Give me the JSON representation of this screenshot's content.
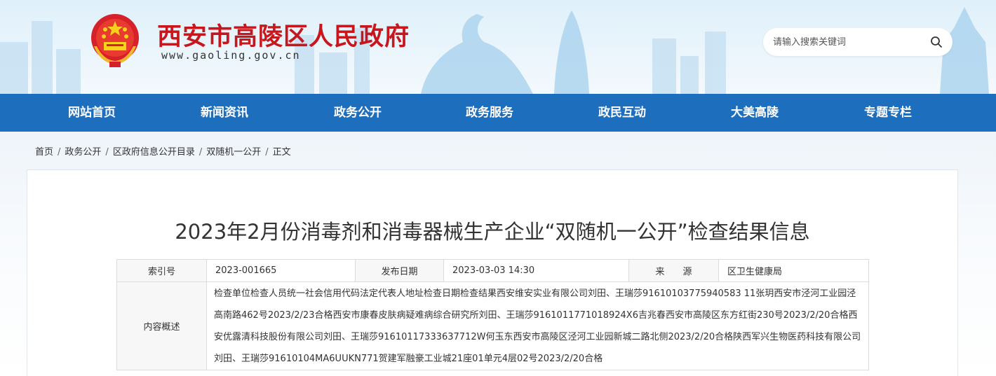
{
  "header": {
    "site_title": "西安市高陵区人民政府",
    "site_domain": "www.gaoling.gov.cn",
    "emblem_icon": "national-emblem-icon",
    "colors": {
      "title_red": "#c8161d",
      "nav_blue": "#1e6ebe"
    }
  },
  "search": {
    "placeholder": "请输入搜索关键词",
    "icon": "search-icon"
  },
  "nav": {
    "items": [
      {
        "label": "网站首页"
      },
      {
        "label": "新闻资讯"
      },
      {
        "label": "政务公开"
      },
      {
        "label": "政务服务"
      },
      {
        "label": "政民互动"
      },
      {
        "label": "大美高陵"
      },
      {
        "label": "专题专栏"
      }
    ]
  },
  "breadcrumb": {
    "items": [
      "首页",
      "政务公开",
      "区政府信息公开目录",
      "双随机一公开",
      "正文"
    ],
    "separator": "/"
  },
  "article": {
    "title": "2023年2月份消毒剂和消毒器械生产企业“双随机一公开”检查结果信息",
    "meta": {
      "index_label": "索引号",
      "index_value": "2023-001665",
      "date_label": "发布日期",
      "date_value": "2023-03-03 14:30",
      "source_label": "来　　源",
      "source_value": "区卫生健康局",
      "summary_label": "内容概述",
      "summary_value": "检查单位检查人员统一社会信用代码法定代表人地址检查日期检查结果西安维安实业有限公司刘田、王瑞莎91610103775940583 11张玥西安市泾河工业园泾高南路462号2023/2/23合格西安市康春皮肤病疑难病综合研究所刘田、王瑞莎9161011771018924X6吉兆春西安市高陵区东方红街230号2023/2/20合格西安优露清科技股份有限公司刘田、王瑞莎91610117333637712W何玉东西安市高陵区泾河工业园新城二路北侧2023/2/20合格陕西军兴生物医药科技有限公司刘田、王瑞莎91610104MA6UUKN771贺建军融豪工业城21座01单元4层02号2023/2/20合格"
    }
  }
}
